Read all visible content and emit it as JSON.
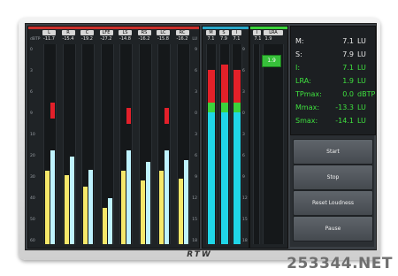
{
  "watermark": "253344.NET",
  "brand": "RTW",
  "left_meters": {
    "unit_left": "dBTP",
    "unit_right": "LU",
    "channels": [
      {
        "label": "L",
        "value": "-11.7",
        "level": 0.47,
        "peak": 0.63
      },
      {
        "label": "R",
        "value": "-15.4",
        "level": 0.44,
        "peak": null
      },
      {
        "label": "C",
        "value": "-19.2",
        "level": 0.37,
        "peak": null
      },
      {
        "label": "LFE",
        "value": "-27.2",
        "level": 0.23,
        "peak": null
      },
      {
        "label": "LS",
        "value": "-14.8",
        "level": 0.47,
        "peak": 0.6
      },
      {
        "label": "RS",
        "value": "-16.2",
        "level": 0.41,
        "peak": null
      },
      {
        "label": "LC",
        "value": "-15.8",
        "level": 0.47,
        "peak": 0.6
      },
      {
        "label": "RC",
        "value": "-16.2",
        "level": 0.42,
        "peak": null
      }
    ],
    "dbtp_scale": [
      "0",
      "3",
      "6",
      "9",
      "10",
      "20",
      "30",
      "40",
      "50",
      "60"
    ],
    "lu_scale": [
      "9",
      "6",
      "3",
      "0",
      "3",
      "6",
      "9",
      "12",
      "15",
      "18"
    ]
  },
  "mid_meters": {
    "channels": [
      {
        "label": "M",
        "value": "7.1",
        "level": 0.87
      },
      {
        "label": "S",
        "value": "7.9",
        "level": 0.9
      },
      {
        "label": "I",
        "value": "7.1",
        "level": 0.87
      }
    ],
    "scale": [
      "9",
      "6",
      "3",
      "0",
      "3",
      "6",
      "9",
      "12",
      "15",
      "18"
    ]
  },
  "right_meter": {
    "labels": [
      "I",
      "LRA"
    ],
    "values": [
      "7.1",
      "1.9"
    ],
    "lra_box": "1.9"
  },
  "readout": [
    {
      "label": "M:",
      "value": "7.1",
      "unit": "LU",
      "color": "white"
    },
    {
      "label": "S:",
      "value": "7.9",
      "unit": "LU",
      "color": "white"
    },
    {
      "label": "I:",
      "value": "7.1",
      "unit": "LU",
      "color": "green"
    },
    {
      "label": "LRA:",
      "value": "1.9",
      "unit": "LU",
      "color": "green"
    },
    {
      "label": "TPmax:",
      "value": "0.0",
      "unit": "dBTP",
      "color": "green"
    },
    {
      "label": "Mmax:",
      "value": "-13.3",
      "unit": "LU",
      "color": "green"
    },
    {
      "label": "Smax:",
      "value": "-14.1",
      "unit": "LU",
      "color": "green"
    }
  ],
  "buttons": [
    "Start",
    "Stop",
    "Reset Loudness",
    "Pause"
  ],
  "colors": {
    "bar_low": "#f6e86a",
    "bar_high": "#bff3ff",
    "mid_bar": "#20d6e8",
    "mid_green": "#3cd23c",
    "mid_red": "#e32129",
    "readout_green": "#3fe03f"
  }
}
